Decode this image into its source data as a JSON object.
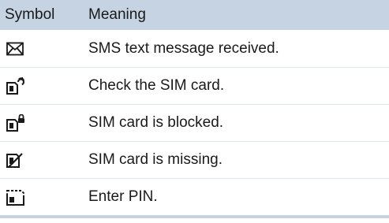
{
  "table": {
    "headers": {
      "symbol": "Symbol",
      "meaning": "Meaning"
    },
    "rows": [
      {
        "icon": "envelope-icon",
        "meaning": "SMS text message received."
      },
      {
        "icon": "sim-check-icon",
        "meaning": "Check the SIM card."
      },
      {
        "icon": "sim-locked-icon",
        "meaning": "SIM card is blocked."
      },
      {
        "icon": "sim-missing-icon",
        "meaning": "SIM card is missing."
      },
      {
        "icon": "sim-pin-icon",
        "meaning": "Enter PIN."
      }
    ]
  },
  "colors": {
    "header_background": "#c5d3e2",
    "row_divider": "#dce4ee",
    "text": "#1a1a1a"
  }
}
